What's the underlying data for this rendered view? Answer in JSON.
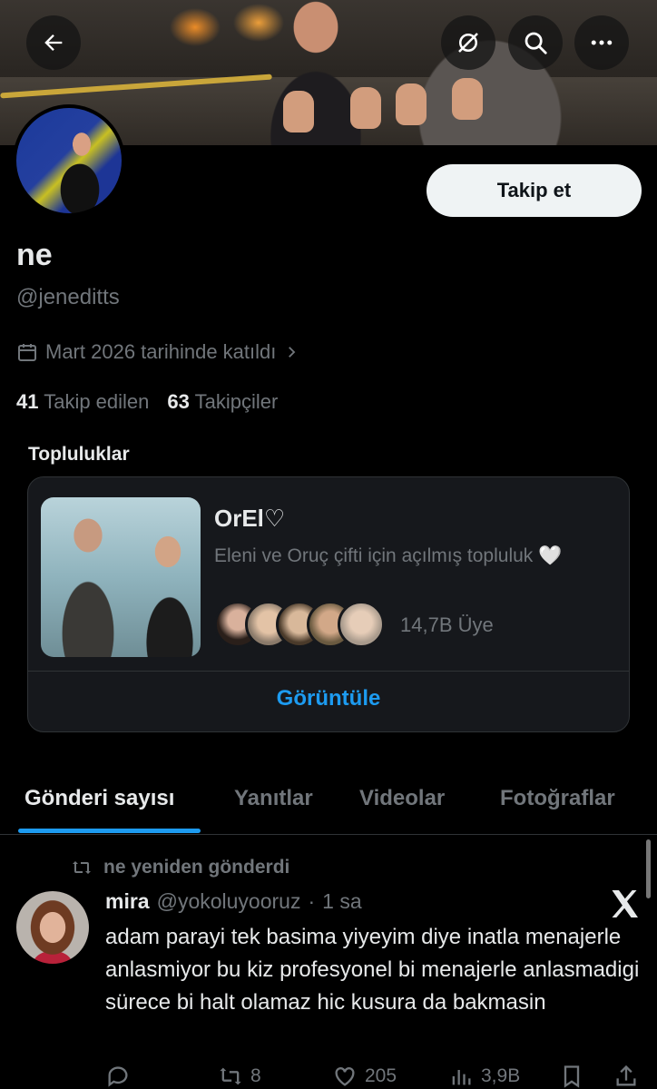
{
  "header": {
    "back_icon": "arrow-left-icon",
    "mute_icon": "hide-icon",
    "search_icon": "search-icon",
    "more_icon": "more-icon"
  },
  "profile": {
    "follow_label": "Takip et",
    "display_name": "ne",
    "handle": "@jeneditts",
    "joined": "Mart 2026 tarihinde katıldı",
    "following_count": "41",
    "following_label": "Takip edilen",
    "followers_count": "63",
    "followers_label": "Takipçiler"
  },
  "communities": {
    "section_title": "Topluluklar",
    "name": "OrEl♡",
    "description": "Eleni ve Oruç çifti için açılmış topluluk 🤍",
    "member_count": "14,7B Üye",
    "view_label": "Görüntüle"
  },
  "tabs": [
    {
      "label": "Gönderi sayısı",
      "active": true
    },
    {
      "label": "Yanıtlar",
      "active": false
    },
    {
      "label": "Videolar",
      "active": false
    },
    {
      "label": "Fotoğraflar",
      "active": false
    }
  ],
  "tweet": {
    "repost_label": "ne yeniden gönderdi",
    "author": "mira",
    "handle": "@yokoluyooruz",
    "separator": "·",
    "time": "1 sa",
    "text": "adam parayi tek basima yiyeyim diye inatla menajerle anlasmiyor bu kiz profesyonel bi menajerle anlasmadigi sürece bi halt olamaz hic kusura da bakmasin",
    "reply_count": "",
    "retweet_count": "8",
    "like_count": "205",
    "views_count": "3,9B"
  },
  "colors": {
    "background": "#000000",
    "text_primary": "#e7e9ea",
    "text_secondary": "#71767b",
    "accent": "#1d9bf0",
    "border": "#2f3336"
  }
}
